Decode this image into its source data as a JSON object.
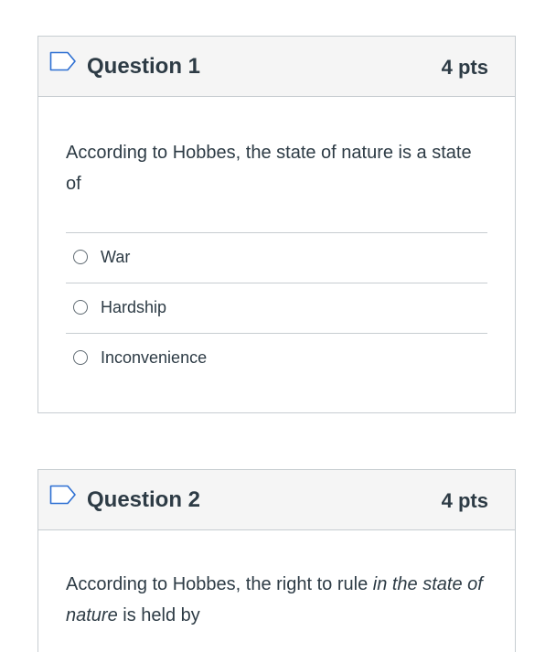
{
  "questions": [
    {
      "title": "Question 1",
      "points": "4 pts",
      "text": "According to Hobbes, the state of nature is a state of",
      "answers": [
        "War",
        "Hardship",
        "Inconvenience"
      ]
    },
    {
      "title": "Question 2",
      "points": "4 pts",
      "text_before": "According to Hobbes, the right to rule ",
      "text_italic": "in the state of nature",
      "text_after": " is held by"
    }
  ],
  "colors": {
    "header_bg": "#f5f5f5",
    "border": "#c7cdd1",
    "text": "#2d3b45",
    "flag_stroke": "#2d6fd2"
  }
}
